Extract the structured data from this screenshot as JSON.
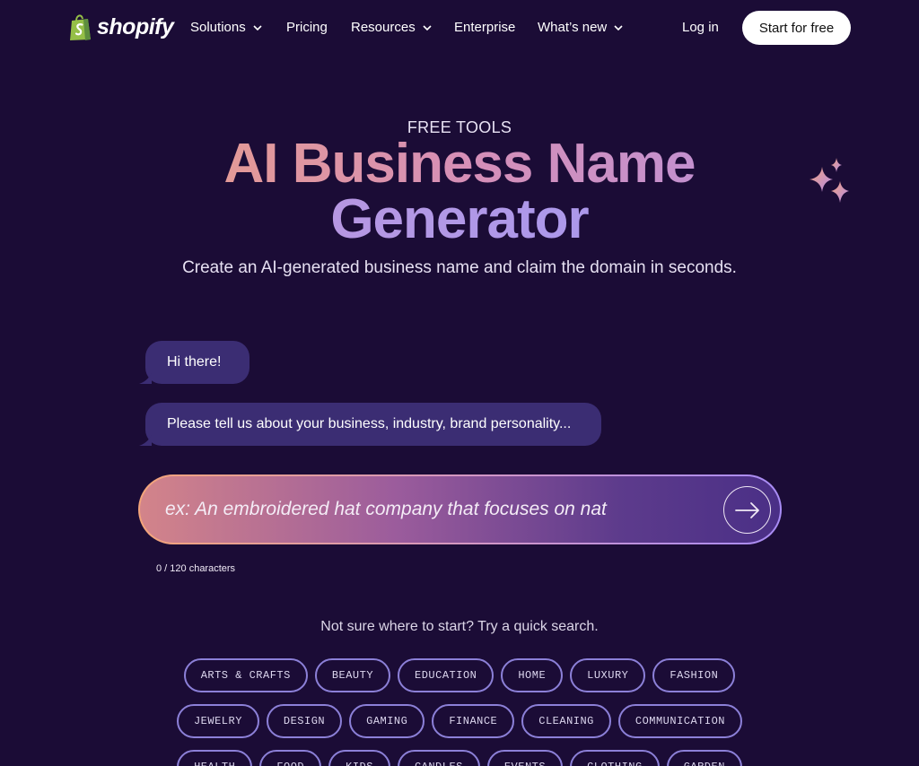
{
  "nav": {
    "logo_text": "shopify",
    "items": [
      {
        "label": "Solutions",
        "has_dropdown": true
      },
      {
        "label": "Pricing",
        "has_dropdown": false
      },
      {
        "label": "Resources",
        "has_dropdown": true
      },
      {
        "label": "Enterprise",
        "has_dropdown": false
      },
      {
        "label": "What’s new",
        "has_dropdown": true
      }
    ],
    "login_label": "Log in",
    "cta_label": "Start for free"
  },
  "hero": {
    "eyebrow": "FREE TOOLS",
    "title_line1": "AI Business Name",
    "title_line2": "Generator",
    "subtitle": "Create an AI-generated business name and claim the domain in seconds."
  },
  "chat": {
    "messages": [
      "Hi there!",
      "Please tell us about your business, industry, brand personality..."
    ]
  },
  "prompt": {
    "placeholder": "ex: An embroidered hat company that focuses on nat",
    "value": "",
    "char_count": "0 / 120 characters"
  },
  "quick_search": {
    "hint": "Not sure where to start? Try a quick search.",
    "rows": [
      [
        "ARTS & CRAFTS",
        "BEAUTY",
        "EDUCATION",
        "HOME",
        "LUXURY",
        "FASHION"
      ],
      [
        "JEWELRY",
        "DESIGN",
        "GAMING",
        "FINANCE",
        "CLEANING",
        "COMMUNICATION"
      ],
      [
        "HEALTH",
        "FOOD",
        "KIDS",
        "CANDLES",
        "EVENTS",
        "CLOTHING",
        "GARDEN"
      ]
    ]
  },
  "colors": {
    "background": "#1b0c36",
    "bubble": "#3b2d73",
    "chip_border": "#8c80d8",
    "logo_green": "#95bf47"
  }
}
